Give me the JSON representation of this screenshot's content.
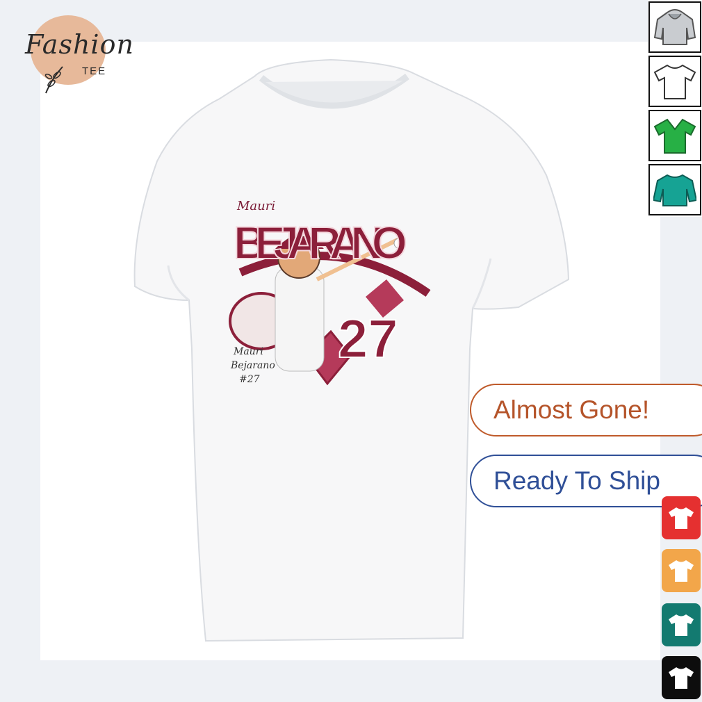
{
  "brand": {
    "name": "Fashion",
    "sub": "TEE"
  },
  "product": {
    "print": {
      "first_name": "Mauri",
      "last_name": "BEJARANO",
      "number": "27",
      "signature_line1": "Mauri",
      "signature_line2": "Bejarano",
      "signature_line3": "#27"
    }
  },
  "badges": {
    "stock": "Almost Gone!",
    "shipping": "Ready To Ship"
  },
  "variants": [
    {
      "icon": "hoodie-icon",
      "color": "#9aa0a6"
    },
    {
      "icon": "tshirt-icon",
      "color": "#ffffff"
    },
    {
      "icon": "vneck-icon",
      "color": "#27b045"
    },
    {
      "icon": "sweatshirt-icon",
      "color": "#16a394"
    }
  ],
  "colors": [
    {
      "name": "red",
      "hex": "#e53030"
    },
    {
      "name": "orange",
      "hex": "#f2a64a"
    },
    {
      "name": "teal",
      "hex": "#137a70"
    },
    {
      "name": "black",
      "hex": "#0d0d0d"
    }
  ]
}
